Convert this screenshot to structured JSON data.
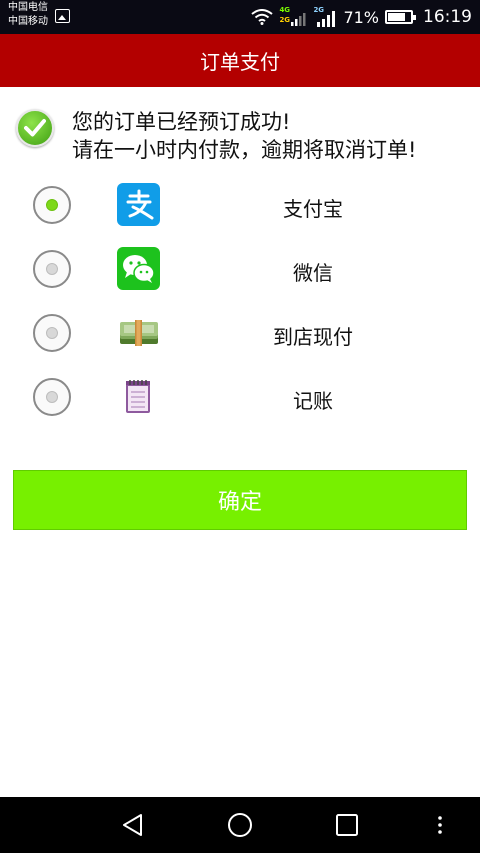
{
  "status_bar": {
    "carrier_1": "中国电信",
    "carrier_2": "中国移动",
    "network_1": "4G",
    "network_2": "2G",
    "network_3": "2G",
    "battery_percent": "71%",
    "time": "16:19"
  },
  "header": {
    "title": "订单支付"
  },
  "message": {
    "line1": "您的订单已经预订成功!",
    "line2": "请在一小时内付款，逾期将取消订单!"
  },
  "payment_options": [
    {
      "label": "支付宝",
      "icon": "alipay-icon",
      "selected": true
    },
    {
      "label": "微信",
      "icon": "wechat-icon",
      "selected": false
    },
    {
      "label": "到店现付",
      "icon": "cash-icon",
      "selected": false
    },
    {
      "label": "记账",
      "icon": "ledger-icon",
      "selected": false
    }
  ],
  "confirm_label": "确定",
  "colors": {
    "header_bg": "#b30000",
    "confirm_bg": "#77f000",
    "radio_selected": "#7dd81a"
  }
}
